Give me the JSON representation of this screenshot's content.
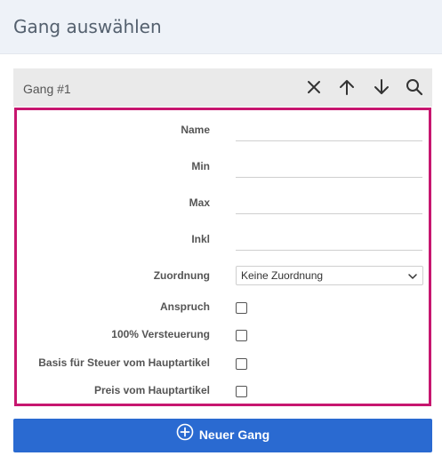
{
  "header": {
    "title": "Gang auswählen"
  },
  "gang_bar": {
    "label": "Gang #1",
    "icons": [
      "close-icon",
      "arrow-up-icon",
      "arrow-down-icon",
      "search-icon"
    ]
  },
  "form": {
    "name_label": "Name",
    "name_value": "",
    "min_label": "Min",
    "min_value": "",
    "max_label": "Max",
    "max_value": "",
    "inkl_label": "Inkl",
    "inkl_value": "",
    "zuordnung_label": "Zuordnung",
    "zuordnung_selected": "Keine Zuordnung",
    "anspruch_label": "Anspruch",
    "anspruch_checked": false,
    "versteuerung_label": "100% Versteuerung",
    "versteuerung_checked": false,
    "basis_label": "Basis für Steuer vom Hauptartikel",
    "basis_checked": false,
    "preis_label": "Preis vom Hauptartikel",
    "preis_checked": false
  },
  "actions": {
    "new_label": "Neuer Gang"
  },
  "colors": {
    "accent": "#2a6ad1",
    "highlight_border": "#c7166f",
    "header_bg": "#eef2f8"
  }
}
